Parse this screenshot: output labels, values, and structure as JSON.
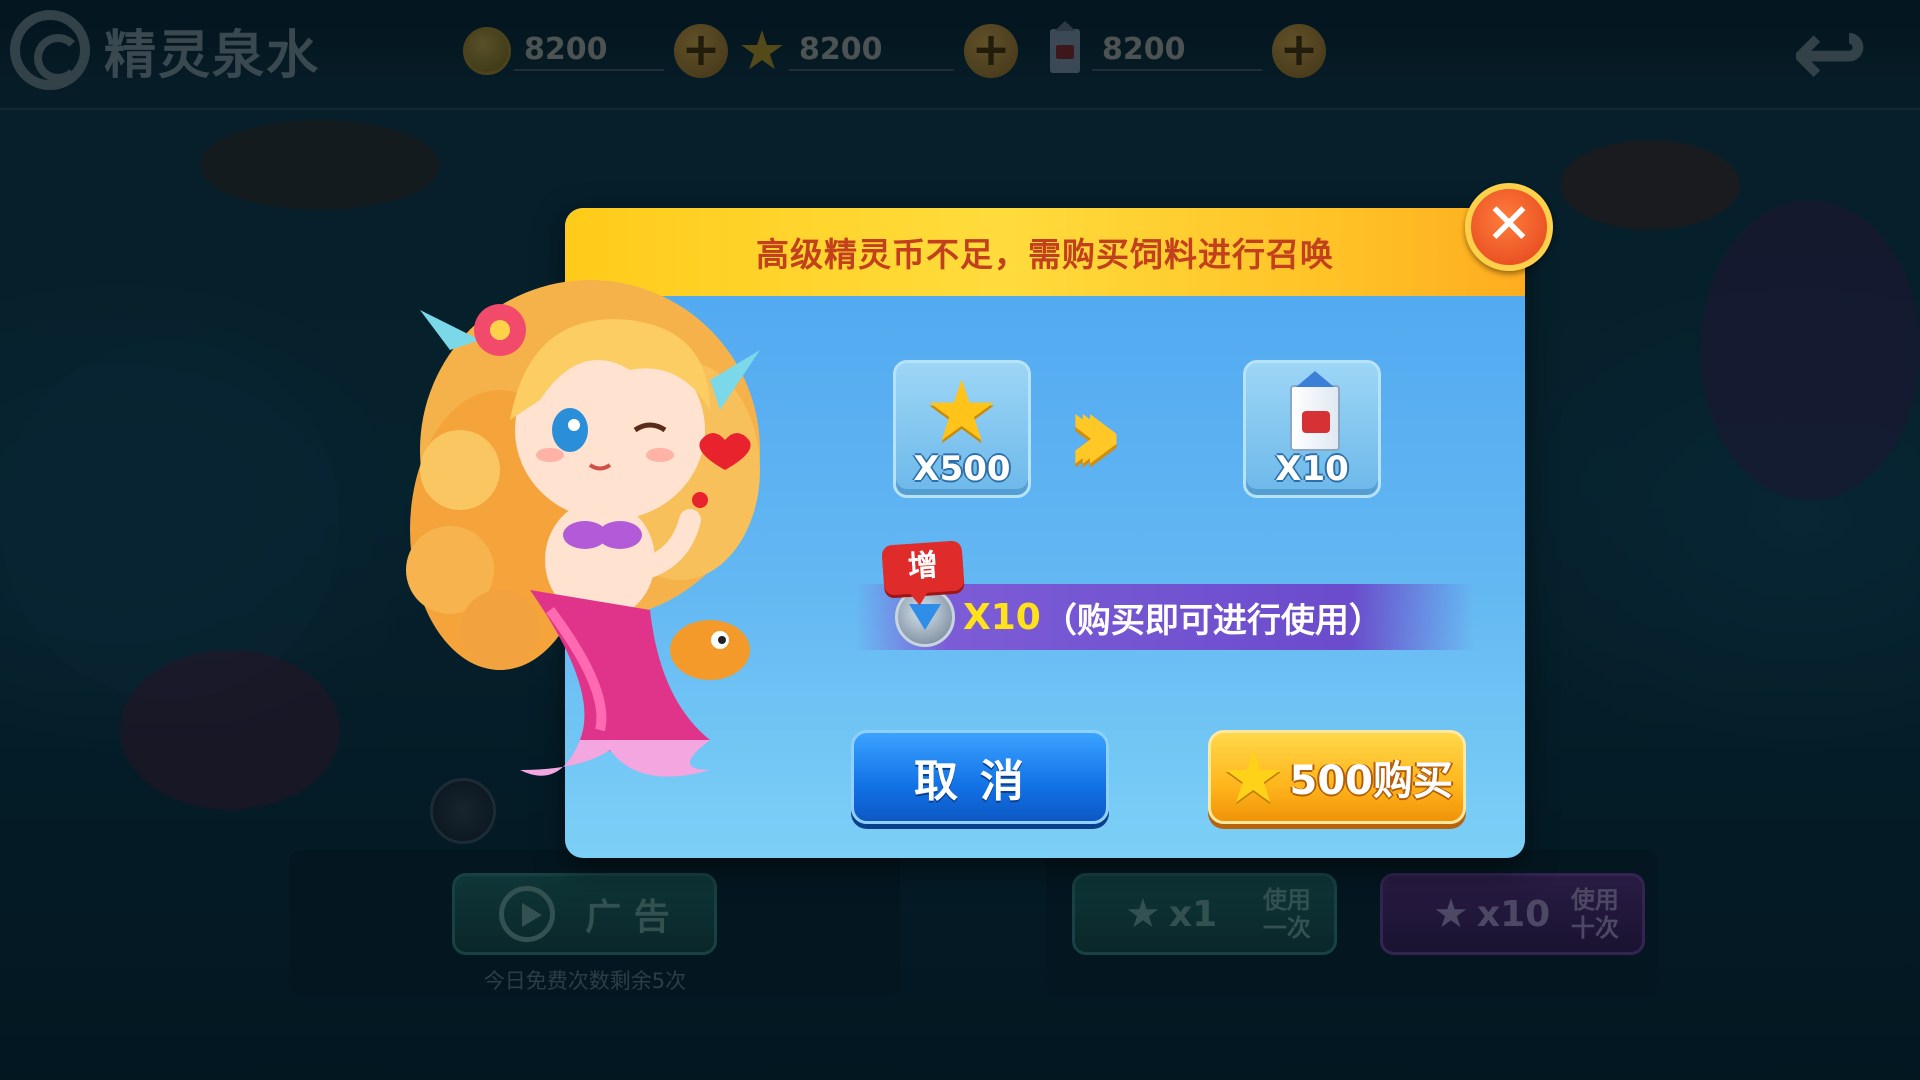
{
  "top_bar": {
    "logo_text": "精灵泉水",
    "currencies": [
      {
        "icon": "coin-icon",
        "value": "8200"
      },
      {
        "icon": "star-icon",
        "value": "8200"
      },
      {
        "icon": "milk-carton-icon",
        "value": "8200"
      }
    ],
    "plus_label": "+",
    "back_icon": "back-arrow-icon"
  },
  "dialog": {
    "title": "高级精灵币不足，需购买饲料进行召唤",
    "close_label": "✕",
    "cost_item": {
      "icon": "star-icon",
      "label": "X500"
    },
    "arrow_glyph": "›››",
    "reward_item": {
      "icon": "milk-carton-icon",
      "label": "X10"
    },
    "bonus": {
      "tag": "增",
      "icon": "gem-icon",
      "count": "X10",
      "note": "（购买即可进行使用）"
    },
    "cancel_label": "取消",
    "buy_label": "500购买"
  },
  "bottom": {
    "ad_label": "广 告",
    "free_note": "今日免费次数剩余5次",
    "use_once": {
      "count": "x1",
      "text": "使用一次"
    },
    "use_ten": {
      "count": "x10",
      "text": "使用十次"
    }
  },
  "colors": {
    "header_yellow": "#ffd23a",
    "title_red": "#c2401e",
    "dialog_blue": "#5cb1f2",
    "cancel_blue": "#1272e6",
    "buy_orange": "#ffb51c",
    "bonus_purple": "#6a4ccc",
    "bonus_yellow": "#ffe21a"
  }
}
